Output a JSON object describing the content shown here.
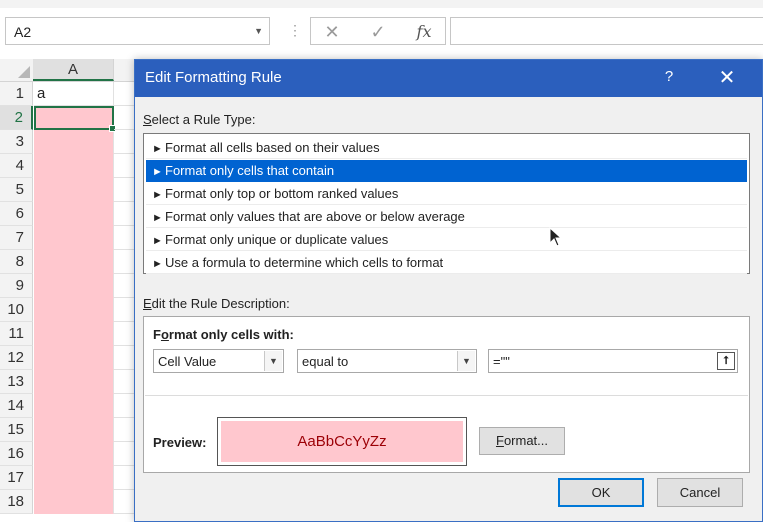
{
  "spreadsheet": {
    "name_box": "A2",
    "formula_buttons": {
      "cancel": "✕",
      "enter": "✓",
      "fx": "fx"
    },
    "formula_value": "",
    "column_header": "A",
    "row_numbers": [
      "1",
      "2",
      "3",
      "4",
      "5",
      "6",
      "7",
      "8",
      "9",
      "10",
      "11",
      "12",
      "13",
      "14",
      "15",
      "16",
      "17",
      "18"
    ],
    "selected_row": "2",
    "cell_A1": "a",
    "highlight_color": "#ffc7ce"
  },
  "dialog": {
    "title": "Edit Formatting Rule",
    "help": "?",
    "close": "✕",
    "rule_type_label_accel": "S",
    "rule_type_label_rest": "elect a Rule Type:",
    "rule_types": [
      "Format all cells based on their values",
      "Format only cells that contain",
      "Format only top or bottom ranked values",
      "Format only values that are above or below average",
      "Format only unique or duplicate values",
      "Use a formula to determine which cells to format"
    ],
    "selected_rule_index": 1,
    "bullet": "►",
    "desc_label_accel": "E",
    "desc_label_rest": "dit the Rule Description:",
    "desc_heading_accel": "o",
    "desc_heading_pre": "F",
    "desc_heading_rest": "rmat only cells with:",
    "condition_field": "Cell Value",
    "operator": "equal to",
    "value": "=\"\"",
    "preview_label": "Preview:",
    "preview_text": "AaBbCcYyZz",
    "preview_fill": "#ffc7ce",
    "preview_font_color": "#9c0006",
    "format_button_accel": "F",
    "format_button_rest": "ormat...",
    "ok": "OK",
    "cancel": "Cancel",
    "accent": "#2b5fbd",
    "selection": "#0063d1"
  }
}
